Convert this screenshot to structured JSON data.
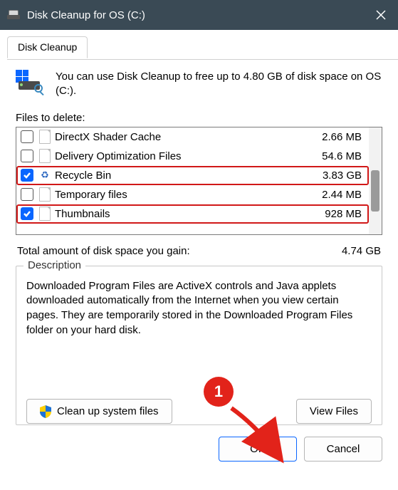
{
  "titlebar": {
    "title": "Disk Cleanup for OS (C:)"
  },
  "tabs": [
    {
      "label": "Disk Cleanup"
    }
  ],
  "intro": "You can use Disk Cleanup to free up to 4.80 GB of disk space on OS (C:).",
  "files_label": "Files to delete:",
  "files": [
    {
      "checked": false,
      "icon": "page",
      "name": "DirectX Shader Cache",
      "size": "2.66 MB",
      "highlight": false
    },
    {
      "checked": false,
      "icon": "page",
      "name": "Delivery Optimization Files",
      "size": "54.6 MB",
      "highlight": false
    },
    {
      "checked": true,
      "icon": "recycle",
      "name": "Recycle Bin",
      "size": "3.83 GB",
      "highlight": true
    },
    {
      "checked": false,
      "icon": "page",
      "name": "Temporary files",
      "size": "2.44 MB",
      "highlight": false
    },
    {
      "checked": true,
      "icon": "page",
      "name": "Thumbnails",
      "size": "928 MB",
      "highlight": true
    }
  ],
  "total": {
    "label": "Total amount of disk space you gain:",
    "value": "4.74 GB"
  },
  "group": {
    "title": "Description",
    "text": "Downloaded Program Files are ActiveX controls and Java applets downloaded automatically from the Internet when you view certain pages. They are temporarily stored in the Downloaded Program Files folder on your hard disk.",
    "cleanup_button": "Clean up system files",
    "viewfiles_button": "View Files"
  },
  "footer": {
    "ok": "OK",
    "cancel": "Cancel"
  },
  "annotation": {
    "badge": "1"
  }
}
